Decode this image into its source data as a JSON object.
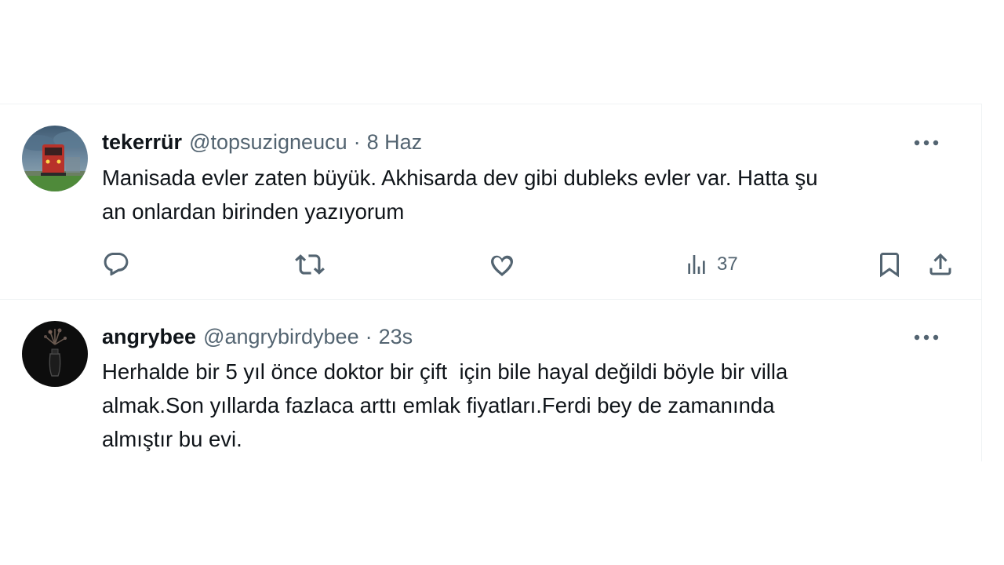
{
  "tweets": [
    {
      "display_name": "tekerrür",
      "handle": "@topsuzigneucu",
      "separator": "·",
      "time": "8 Haz",
      "text": "Manisada evler zaten büyük. Akhisarda dev gibi dubleks evler var. Hatta şu\nan onlardan birinden yazıyorum",
      "views": "37",
      "avatar_icon": "train-photo-avatar",
      "more_icon": "more-icon"
    },
    {
      "display_name": "angrybee",
      "handle": "@angrybirdybee",
      "separator": "·",
      "time": "23s",
      "text": "Herhalde bir 5 yıl önce doktor bir çift  için bile hayal değildi böyle bir villa\nalmak.Son yıllarda fazlaca arttı emlak fiyatları.Ferdi bey de zamanında\nalmıştır bu evi.",
      "avatar_icon": "dark-vase-avatar",
      "more_icon": "more-icon"
    }
  ],
  "colors": {
    "text_primary": "#0f1419",
    "text_secondary": "#536471",
    "divider": "#eff3f4"
  }
}
